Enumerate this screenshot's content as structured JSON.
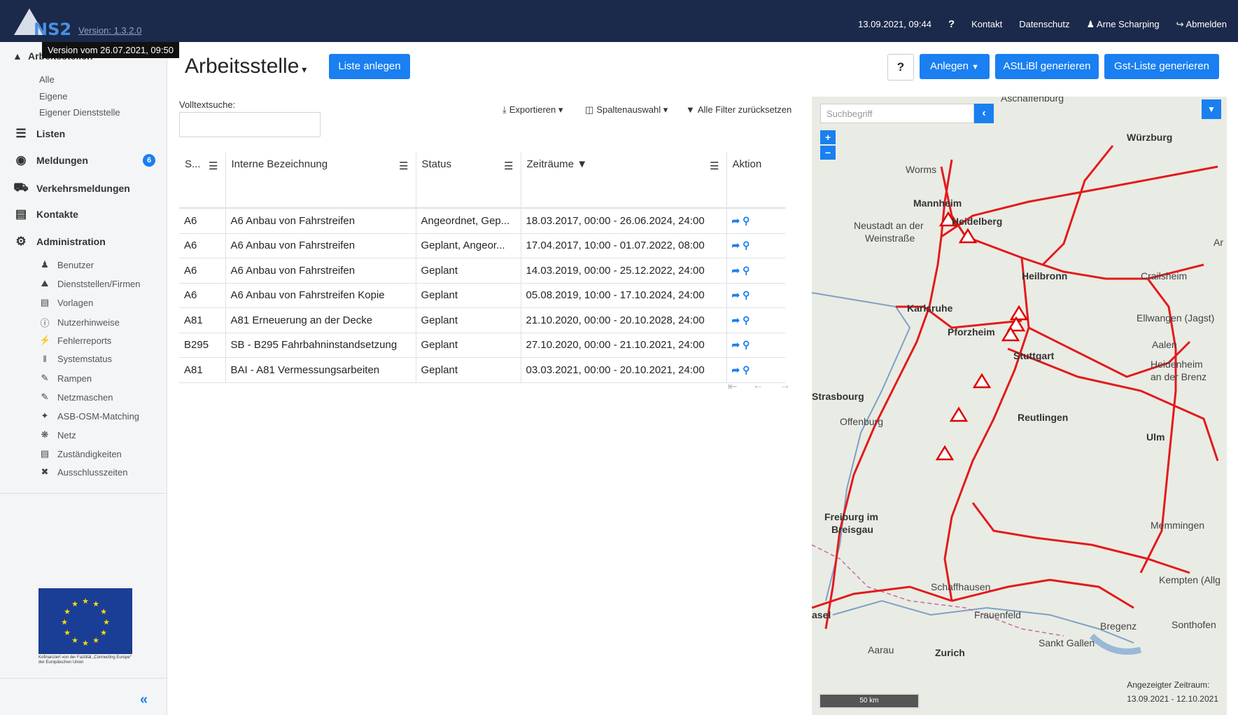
{
  "header": {
    "logo_text": "NS2",
    "version_link": "Version: 1.3.2.0",
    "datetime": "13.09.2021, 09:44",
    "help": "?",
    "contact": "Kontakt",
    "privacy": "Datenschutz",
    "user": "Arne Scharping",
    "logout": "Abmelden"
  },
  "tooltip": "Version vom 26.07.2021, 09:50",
  "sidebar": {
    "section_title": "Arbeitsstellen",
    "sub_items": [
      "Alle",
      "Eigene",
      "Eigener Dienststelle"
    ],
    "main_items": [
      {
        "label": "Listen",
        "icon": "list-icon"
      },
      {
        "label": "Meldungen",
        "icon": "comment-icon",
        "badge": "6"
      },
      {
        "label": "Verkehrsmeldungen",
        "icon": "car-icon"
      },
      {
        "label": "Kontakte",
        "icon": "address-book-icon"
      },
      {
        "label": "Administration",
        "icon": "gear-icon"
      }
    ],
    "admin_items": [
      {
        "label": "Benutzer",
        "icon": "user-icon"
      },
      {
        "label": "Dienststellen/Firmen",
        "icon": "building-icon"
      },
      {
        "label": "Vorlagen",
        "icon": "file-icon"
      },
      {
        "label": "Nutzerhinweise",
        "icon": "info-icon"
      },
      {
        "label": "Fehlerreports",
        "icon": "bolt-icon"
      },
      {
        "label": "Systemstatus",
        "icon": "thermometer-icon"
      },
      {
        "label": "Rampen",
        "icon": "edit-icon"
      },
      {
        "label": "Netzmaschen",
        "icon": "edit-icon"
      },
      {
        "label": "ASB-OSM-Matching",
        "icon": "wand-icon"
      },
      {
        "label": "Netz",
        "icon": "network-icon"
      },
      {
        "label": "Zuständigkeiten",
        "icon": "book-icon"
      },
      {
        "label": "Ausschlusszeiten",
        "icon": "x-circle-icon"
      }
    ],
    "eu_caption": "Kofinanziert von der Fazilität „Connecting Europe“ der Europäischen Union"
  },
  "main": {
    "title": "Arbeitsstelle",
    "list_button": "Liste anlegen",
    "help_button": "?",
    "create_button": "Anlegen",
    "astlibi_button": "AStLiBl generieren",
    "gst_button": "Gst-Liste generieren",
    "search_label": "Volltextsuche:",
    "export": "Exportieren",
    "columns": "Spaltenauswahl",
    "reset_filters": "Alle Filter zurücksetzen"
  },
  "table": {
    "headers": [
      "S...",
      "Interne Bezeichnung",
      "Status",
      "Zeiträume",
      "Aktion"
    ],
    "rows": [
      [
        "A6",
        "A6 Anbau von Fahrstreifen",
        "Angeordnet, Gep...",
        "18.03.2017, 00:00 - 26.06.2024, 24:00"
      ],
      [
        "A6",
        "A6 Anbau von Fahrstreifen",
        "Geplant, Angeor...",
        "17.04.2017, 10:00 - 01.07.2022, 08:00"
      ],
      [
        "A6",
        "A6 Anbau von Fahrstreifen",
        "Geplant",
        "14.03.2019, 00:00 - 25.12.2022, 24:00"
      ],
      [
        "A6",
        "A6 Anbau von Fahrstreifen Kopie",
        "Geplant",
        "05.08.2019, 10:00 - 17.10.2024, 24:00"
      ],
      [
        "A81",
        "A81 Erneuerung an der Decke",
        "Geplant",
        "21.10.2020, 00:00 - 20.10.2028, 24:00"
      ],
      [
        "B295",
        "SB - B295 Fahrbahninstandsetzung",
        "Geplant",
        "27.10.2020, 00:00 - 21.10.2021, 24:00"
      ],
      [
        "A81",
        "BAI - A81 Vermessungsarbeiten",
        "Geplant",
        "03.03.2021, 00:00 - 20.10.2021, 24:00"
      ]
    ]
  },
  "map": {
    "search_placeholder": "Suchbegriff",
    "scale": "50 km",
    "period_label": "Angezeigter Zeitraum:",
    "period_value": "13.09.2021 - 12.10.2021",
    "cities": [
      {
        "name": "Aschaffenburg",
        "bold": false
      },
      {
        "name": "Würzburg",
        "bold": true
      },
      {
        "name": "Worms",
        "bold": false
      },
      {
        "name": "Mannheim",
        "bold": true
      },
      {
        "name": "Heidelberg",
        "bold": true
      },
      {
        "name": "Neustadt an der",
        "bold": false
      },
      {
        "name": "Weinstraße",
        "bold": false
      },
      {
        "name": "Heilbronn",
        "bold": true
      },
      {
        "name": "Crailsheim",
        "bold": false
      },
      {
        "name": "Karlsruhe",
        "bold": true
      },
      {
        "name": "Pforzheim",
        "bold": true
      },
      {
        "name": "Ellwangen (Jagst)",
        "bold": false
      },
      {
        "name": "Aalen",
        "bold": false
      },
      {
        "name": "Stuttgart",
        "bold": true
      },
      {
        "name": "Heidenheim",
        "bold": false
      },
      {
        "name": "an der Brenz",
        "bold": false
      },
      {
        "name": "Strasbourg",
        "bold": true
      },
      {
        "name": "Offenburg",
        "bold": false
      },
      {
        "name": "Reutlingen",
        "bold": true
      },
      {
        "name": "Ulm",
        "bold": true
      },
      {
        "name": "Freiburg im",
        "bold": true
      },
      {
        "name": "Breisgau",
        "bold": true
      },
      {
        "name": "Memmingen",
        "bold": false
      },
      {
        "name": "Kempten (Allg",
        "bold": false
      },
      {
        "name": "Schaffhausen",
        "bold": false
      },
      {
        "name": "Frauenfeld",
        "bold": false
      },
      {
        "name": "Bregenz",
        "bold": false
      },
      {
        "name": "Sonthofen",
        "bold": false
      },
      {
        "name": "Sankt Gallen",
        "bold": false
      },
      {
        "name": "Aarau",
        "bold": false
      },
      {
        "name": "Zurich",
        "bold": true
      },
      {
        "name": "Ar",
        "bold": false
      },
      {
        "name": "asel",
        "bold": true
      }
    ]
  },
  "colors": {
    "navbar": "#1b2a4a",
    "accent": "#1a7ff0",
    "road": "#e31a1c"
  }
}
